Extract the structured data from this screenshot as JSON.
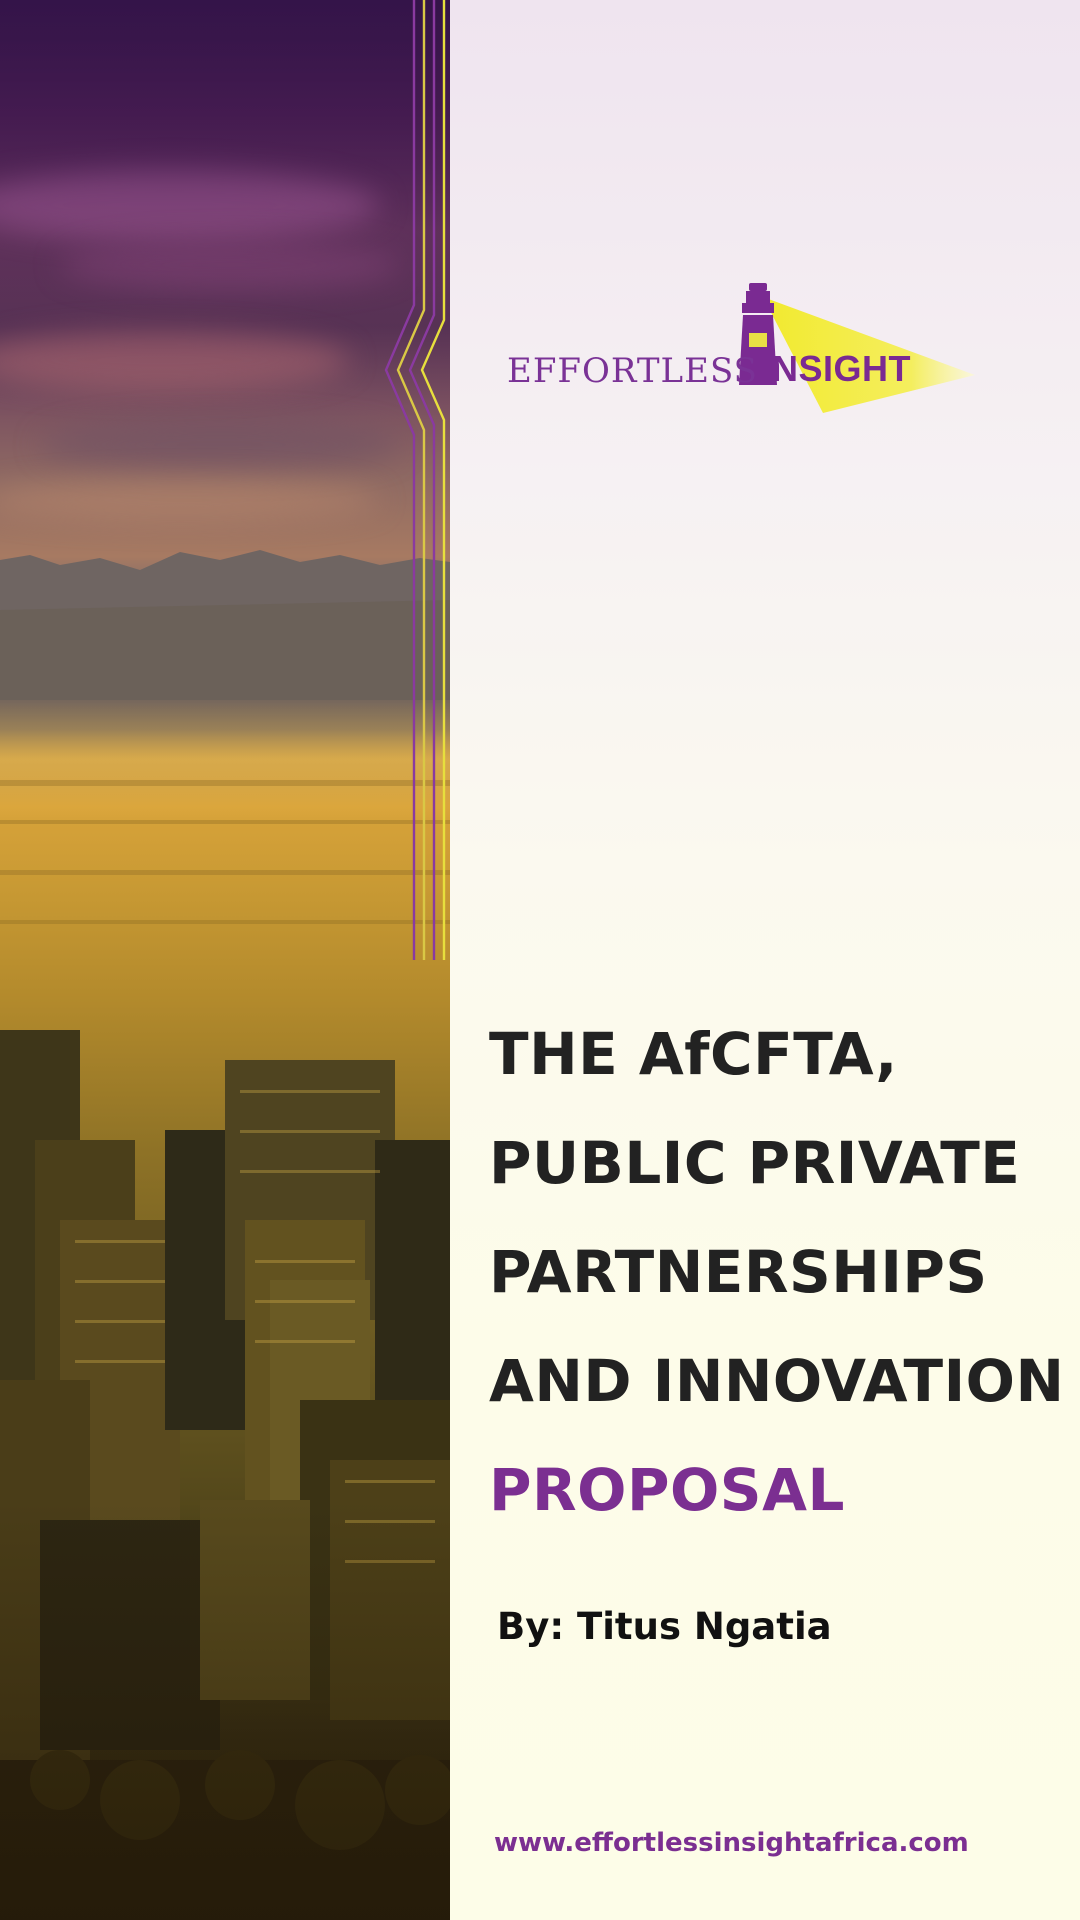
{
  "logo": {
    "word_left": "EFFORTLESS",
    "word_right": "NSIGHT",
    "icon": "lighthouse-icon"
  },
  "title": {
    "lines": [
      "THE AfCFTA,",
      "PUBLIC PRIVATE",
      "PARTNERSHIPS",
      "AND INNOVATION"
    ],
    "accent": "PROPOSAL"
  },
  "author": "By: Titus Ngatia",
  "website": "www.effortlessinsightafrica.com",
  "colors": {
    "accent_purple": "#7b2f91",
    "title_text": "#222222",
    "logo_yellow": "#f2ea2e",
    "panel_background": "#fdfce9"
  }
}
